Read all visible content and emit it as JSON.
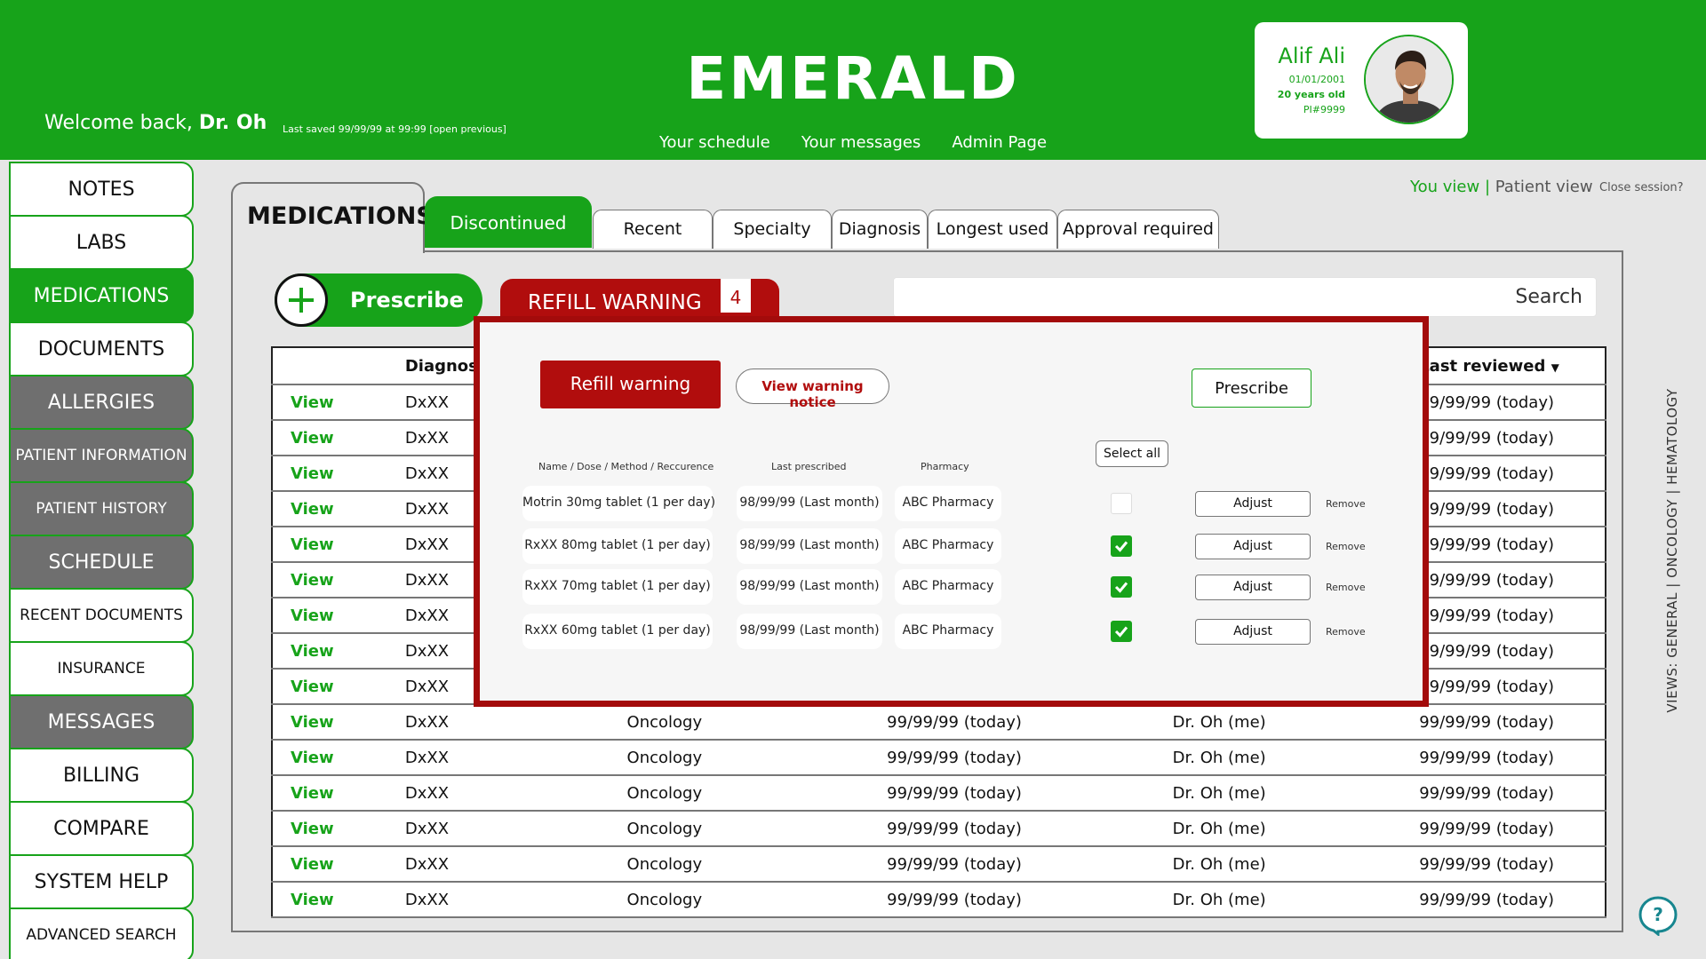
{
  "app": {
    "title": "EMERALD"
  },
  "header": {
    "welcome_prefix": "Welcome back, ",
    "welcome_name": "Dr. Oh",
    "last_saved": "Last saved 99/99/99 at 99:99  [open previous]",
    "nav": [
      "Your schedule",
      "Your messages",
      "Admin Page"
    ]
  },
  "patient": {
    "name": "Alif Ali",
    "dob": "01/01/2001",
    "age": "20 years old",
    "pid": "PI#9999"
  },
  "sidebar": {
    "items": [
      {
        "label": "NOTES",
        "style": "light"
      },
      {
        "label": "LABS",
        "style": "light"
      },
      {
        "label": "MEDICATIONS",
        "style": "active"
      },
      {
        "label": "DOCUMENTS",
        "style": "light"
      },
      {
        "label": "ALLERGIES",
        "style": "dark"
      },
      {
        "label": "PATIENT INFORMATION",
        "style": "dark"
      },
      {
        "label": "PATIENT HISTORY",
        "style": "dark"
      },
      {
        "label": "SCHEDULE",
        "style": "dark"
      },
      {
        "label": "RECENT DOCUMENTS",
        "style": "light"
      },
      {
        "label": "INSURANCE",
        "style": "light"
      },
      {
        "label": "MESSAGES",
        "style": "dark"
      },
      {
        "label": "BILLING",
        "style": "light"
      },
      {
        "label": "COMPARE",
        "style": "light"
      },
      {
        "label": "SYSTEM HELP",
        "style": "light"
      },
      {
        "label": "ADVANCED SEARCH",
        "style": "light"
      }
    ]
  },
  "tabs": {
    "section_title": "MEDICATIONS",
    "discontinued": "Discontinued",
    "items": [
      "Recent",
      "Specialty",
      "Diagnosis",
      "Longest used",
      "Approval required"
    ]
  },
  "view_toggle": {
    "you_view": "You view",
    "separator": "|",
    "patient_view": "Patient view",
    "close_session": "Close session?"
  },
  "toolbar": {
    "prescribe_label": "Prescribe",
    "refill_label": "REFILL WARNING",
    "refill_count": "4",
    "search_placeholder": "Search"
  },
  "table": {
    "headers": [
      "",
      "Diagnosis",
      "",
      "",
      "",
      "Last reviewed"
    ],
    "rows": [
      [
        "View",
        "DxXX",
        "",
        "",
        "",
        "99/99/99 (today)"
      ],
      [
        "View",
        "DxXX",
        "",
        "",
        "",
        "99/99/99 (today)"
      ],
      [
        "View",
        "DxXX",
        "",
        "",
        "",
        "99/99/99 (today)"
      ],
      [
        "View",
        "DxXX",
        "",
        "",
        "",
        "99/99/99 (today)"
      ],
      [
        "View",
        "DxXX",
        "",
        "",
        "",
        "99/99/99 (today)"
      ],
      [
        "View",
        "DxXX",
        "",
        "",
        "",
        "99/99/99 (today)"
      ],
      [
        "View",
        "DxXX",
        "",
        "",
        "",
        "99/99/99 (today)"
      ],
      [
        "View",
        "DxXX",
        "",
        "",
        "",
        "99/99/99 (today)"
      ],
      [
        "View",
        "DxXX",
        "",
        "",
        "",
        "99/99/99 (today)"
      ],
      [
        "View",
        "DxXX",
        "Oncology",
        "99/99/99 (today)",
        "Dr. Oh (me)",
        "99/99/99 (today)"
      ],
      [
        "View",
        "DxXX",
        "Oncology",
        "99/99/99 (today)",
        "Dr. Oh (me)",
        "99/99/99 (today)"
      ],
      [
        "View",
        "DxXX",
        "Oncology",
        "99/99/99 (today)",
        "Dr. Oh (me)",
        "99/99/99 (today)"
      ],
      [
        "View",
        "DxXX",
        "Oncology",
        "99/99/99 (today)",
        "Dr. Oh (me)",
        "99/99/99 (today)"
      ],
      [
        "View",
        "DxXX",
        "Oncology",
        "99/99/99 (today)",
        "Dr. Oh (me)",
        "99/99/99 (today)"
      ],
      [
        "View",
        "DxXX",
        "Oncology",
        "99/99/99 (today)",
        "Dr. Oh (me)",
        "99/99/99 (today)"
      ]
    ]
  },
  "modal": {
    "refill_warning": "Refill warning",
    "view_notice": "View warning notice",
    "prescribe": "Prescribe",
    "col_name": "Name / Dose / Method / Reccurence",
    "col_last": "Last prescribed",
    "col_pharmacy": "Pharmacy",
    "select_all": "Select all",
    "adjust": "Adjust",
    "remove": "Remove",
    "items": [
      {
        "name": "Motrin 30mg tablet (1 per day)",
        "last": "98/99/99 (Last month)",
        "pharmacy": "ABC Pharmacy",
        "checked": false
      },
      {
        "name": "RxXX 80mg tablet (1 per day)",
        "last": "98/99/99 (Last month)",
        "pharmacy": "ABC Pharmacy",
        "checked": true
      },
      {
        "name": "RxXX 70mg tablet (1 per day)",
        "last": "98/99/99 (Last month)",
        "pharmacy": "ABC Pharmacy",
        "checked": true
      },
      {
        "name": "RxXX 60mg tablet (1 per day)",
        "last": "98/99/99 (Last month)",
        "pharmacy": "ABC Pharmacy",
        "checked": true
      }
    ]
  },
  "views_label": "VIEWS: GENERAL | ONCOLOGY | HEMATOLOGY",
  "colors": {
    "brand": "#17a31a",
    "warning": "#b10d0d",
    "panel": "#e6e6e6",
    "dark_item": "#6f6f6f"
  }
}
